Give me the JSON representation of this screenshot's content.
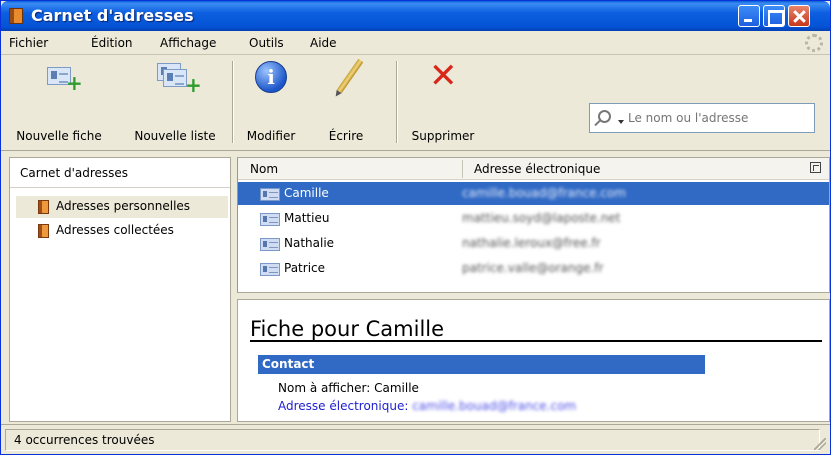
{
  "window": {
    "title": "Carnet d'adresses"
  },
  "menu": [
    "Fichier",
    "Édition",
    "Affichage",
    "Outils",
    "Aide"
  ],
  "toolbar": {
    "new_card": "Nouvelle fiche",
    "new_list": "Nouvelle liste",
    "edit": "Modifier",
    "write": "Écrire",
    "delete": "Supprimer",
    "search_placeholder": "Le nom ou l'adresse"
  },
  "sidebar": {
    "header": "Carnet d'adresses",
    "items": [
      {
        "label": "Adresses personnelles",
        "selected": true
      },
      {
        "label": "Adresses collectées",
        "selected": false
      }
    ]
  },
  "list": {
    "columns": [
      "Nom",
      "Adresse électronique"
    ],
    "rows": [
      {
        "name": "Camille",
        "email": "camille.bouad@france.com",
        "selected": true
      },
      {
        "name": "Mattieu",
        "email": "mattieu.soyd@laposte.net",
        "selected": false
      },
      {
        "name": "Nathalie",
        "email": "nathalie.leroux@free.fr",
        "selected": false
      },
      {
        "name": "Patrice",
        "email": "patrice.valle@orange.fr",
        "selected": false
      }
    ]
  },
  "card": {
    "title": "Fiche pour Camille",
    "section": "Contact",
    "display_name": "Nom à afficher: Camille",
    "email_label": "Adresse électronique:",
    "email_value": "camille.bouad@france.com"
  },
  "status": {
    "text": "4 occurrences trouvées"
  },
  "colors": {
    "selection": "#316ac5",
    "titlebar": "#0553d6",
    "chrome": "#ece9d8",
    "link": "#2020d0"
  }
}
